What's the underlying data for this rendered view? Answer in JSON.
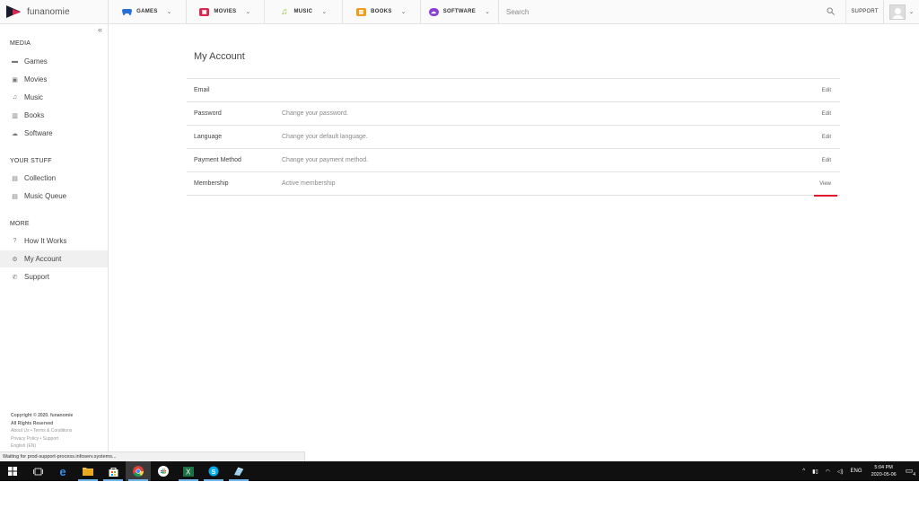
{
  "app": {
    "logo_text": "funanomie"
  },
  "nav": {
    "tabs": [
      {
        "label": "GAMES",
        "icon": "gamepad-icon",
        "color": "#2a6fd6"
      },
      {
        "label": "MOVIES",
        "icon": "film-icon",
        "color": "#d8284f"
      },
      {
        "label": "MUSIC",
        "icon": "music-note-icon",
        "color": "#8fbf1f"
      },
      {
        "label": "BOOKS",
        "icon": "book-icon",
        "color": "#f29a1a"
      },
      {
        "label": "SOFTWARE",
        "icon": "cloud-icon",
        "color": "#8a3fd1"
      }
    ],
    "search_placeholder": "Search",
    "support_label": "SUPPORT"
  },
  "sidebar": {
    "collapse_glyph": "«",
    "sections": [
      {
        "heading": "MEDIA",
        "items": [
          {
            "label": "Games",
            "icon": "gamepad-icon"
          },
          {
            "label": "Movies",
            "icon": "film-icon"
          },
          {
            "label": "Music",
            "icon": "music-note-icon"
          },
          {
            "label": "Books",
            "icon": "book-icon"
          },
          {
            "label": "Software",
            "icon": "cloud-icon"
          }
        ]
      },
      {
        "heading": "YOUR STUFF",
        "items": [
          {
            "label": "Collection",
            "icon": "list-icon"
          },
          {
            "label": "Music Queue",
            "icon": "list-icon"
          }
        ]
      },
      {
        "heading": "MORE",
        "items": [
          {
            "label": "How It Works",
            "icon": "help-circle-icon"
          },
          {
            "label": "My Account",
            "icon": "gear-icon",
            "active": true
          },
          {
            "label": "Support",
            "icon": "phone-icon"
          }
        ]
      }
    ],
    "footer": {
      "copyright": "Copyright © 2020. funanomie",
      "rights": "All Rights Reserved",
      "links1": "About Us  • Terms & Conditions",
      "links2": "Privacy Policy  • Support",
      "language": "English (EN)"
    }
  },
  "main": {
    "title": "My Account",
    "rows": [
      {
        "label": "Email",
        "desc": "",
        "action": "Edit"
      },
      {
        "label": "Password",
        "desc": "Change your password.",
        "action": "Edit"
      },
      {
        "label": "Language",
        "desc": "Change your default language.",
        "action": "Edit"
      },
      {
        "label": "Payment Method",
        "desc": "Change your payment method.",
        "action": "Edit"
      },
      {
        "label": "Membership",
        "desc": "Active membership",
        "action": "View",
        "highlight": true
      }
    ]
  },
  "statusbar": {
    "text": "Waiting for prod-support-process.infoserv.systems..."
  },
  "taskbar": {
    "tray": {
      "language": "ENG",
      "time": "5:04 PM",
      "date": "2020-05-06",
      "notification_count": "4"
    }
  }
}
